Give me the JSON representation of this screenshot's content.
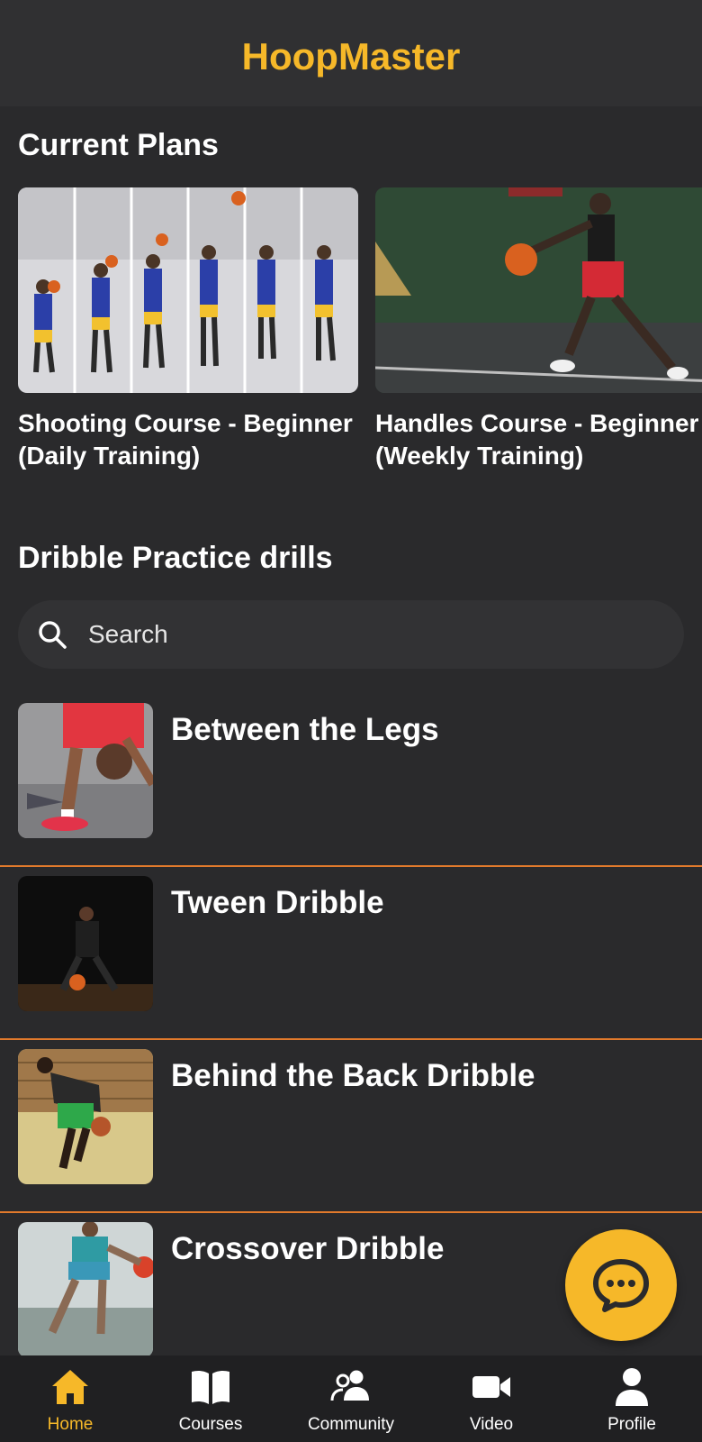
{
  "app": {
    "title": "HoopMaster"
  },
  "sections": {
    "current_plans": "Current Plans",
    "drills": "Dribble Practice drills"
  },
  "plans": [
    {
      "title_line1": "Shooting Course - Beginner",
      "title_line2": "(Daily Training)"
    },
    {
      "title_line1": "Handles Course - Beginner",
      "title_line2": "(Weekly Training)"
    }
  ],
  "search": {
    "placeholder": "Search"
  },
  "drills": [
    {
      "title": "Between the Legs"
    },
    {
      "title": "Tween Dribble"
    },
    {
      "title": "Behind the Back Dribble"
    },
    {
      "title": "Crossover Dribble"
    }
  ],
  "nav": [
    {
      "label": "Home",
      "icon": "home-icon",
      "active": true
    },
    {
      "label": "Courses",
      "icon": "book-icon"
    },
    {
      "label": "Community",
      "icon": "people-icon"
    },
    {
      "label": "Video",
      "icon": "video-camera-icon"
    },
    {
      "label": "Profile",
      "icon": "person-icon"
    }
  ],
  "colors": {
    "accent": "#f6b829",
    "background": "#2a2a2c",
    "divider": "#e27a2c"
  }
}
